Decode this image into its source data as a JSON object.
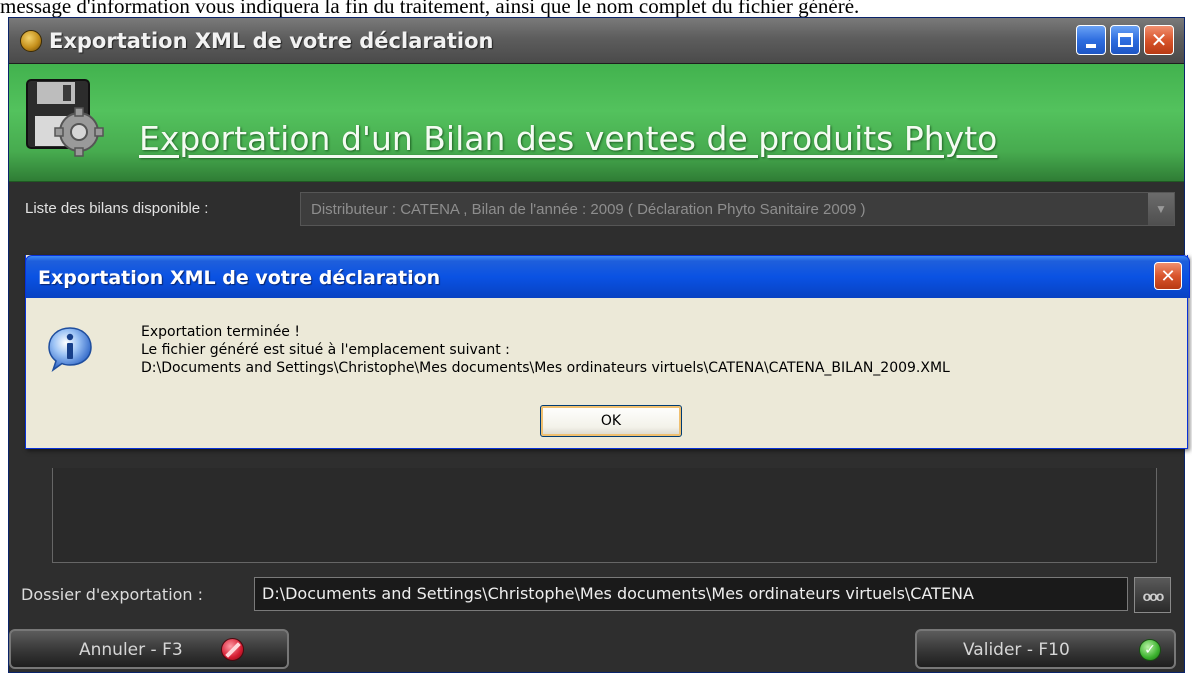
{
  "document": {
    "caption": "message d'information vous indiquera la fin du traitement, ainsi que le nom complet du fichier généré."
  },
  "window": {
    "title": "Exportation XML de votre déclaration",
    "banner_title": "Exportation d'un Bilan des ventes de produits Phyto"
  },
  "list": {
    "label": "Liste des bilans disponible :",
    "selected": "Distributeur : CATENA , Bilan de l'année : 2009 ( Déclaration Phyto Sanitaire 2009 )"
  },
  "export_folder": {
    "label": "Dossier d'exportation :",
    "value": "D:\\Documents and Settings\\Christophe\\Mes documents\\Mes ordinateurs virtuels\\CATENA",
    "browse_label": "ooo"
  },
  "actions": {
    "cancel_label": "Annuler - F3",
    "validate_label": "Valider - F10"
  },
  "dialog": {
    "title": "Exportation XML de votre déclaration",
    "message_line1": "Exportation terminée !",
    "message_line2": "Le fichier généré est situé à l'emplacement suivant :",
    "message_line3": "D:\\Documents and Settings\\Christophe\\Mes documents\\Mes ordinateurs virtuels\\CATENA\\CATENA_BILAN_2009.XML",
    "ok_label": "OK"
  },
  "icons": {
    "app": "app-logo-icon",
    "banner": "floppy-gear-icon",
    "info": "info-icon",
    "cancel": "no-entry-icon",
    "validate": "check-icon"
  },
  "colors": {
    "banner_green": "#4fbf59",
    "xp_blue": "#0a52e3",
    "dialog_bg": "#ece9d8",
    "window_dark": "#2e2e2e"
  }
}
